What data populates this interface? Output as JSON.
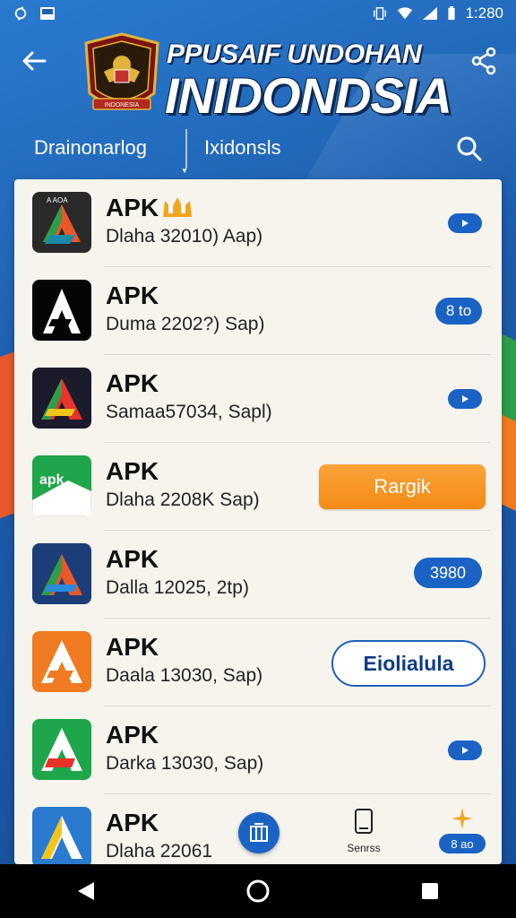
{
  "status_bar": {
    "time": "1:280",
    "icons": [
      "sync-icon",
      "gallery-icon",
      "vibrate-icon",
      "wifi-icon",
      "signal-icon",
      "battery-icon"
    ]
  },
  "header": {
    "title_top": "PPUSAIF UNDOHAN",
    "title_main": "INIDONDSIA",
    "emblem_text": "INDONESIA"
  },
  "tabs": {
    "left": "Drainonarlog",
    "right": "Ixidonsls"
  },
  "apps": [
    {
      "name": "APK",
      "sub": "Dlaha 32010) Aap)",
      "action": "",
      "action_type": "pill-sm",
      "icon": "apk-dark-icon",
      "icon_label": "A AOA"
    },
    {
      "name": "APK",
      "sub": "Duma 2202?) Sap)",
      "action": "8 to",
      "action_type": "pill-med",
      "icon": "apk-black-icon",
      "icon_label": ""
    },
    {
      "name": "APK",
      "sub": "Samaa57034, Sapl)",
      "action": "",
      "action_type": "pill-sm",
      "icon": "apk-red-icon",
      "icon_label": ""
    },
    {
      "name": "APK",
      "sub": "Dlaha 2208K Sap)",
      "action": "Rargik",
      "action_type": "orange",
      "icon": "apk-green-icon",
      "icon_label": "apk"
    },
    {
      "name": "APK",
      "sub": "Dalla 12025, 2tp)",
      "action": "3980",
      "action_type": "pill-big",
      "icon": "apk-navy-icon",
      "icon_label": ""
    },
    {
      "name": "APK",
      "sub": "Daala 13030, Sap)",
      "action": "Eiolialula",
      "action_type": "outline",
      "icon": "apk-orange-icon",
      "icon_label": ""
    },
    {
      "name": "APK",
      "sub": "Darka 13030, Sap)",
      "action": "",
      "action_type": "pill-sm",
      "icon": "apk-lime-icon",
      "icon_label": ""
    },
    {
      "name": "APK",
      "sub": "Dlaha 22061",
      "action": "",
      "action_type": "none",
      "icon": "apk-blue-icon",
      "icon_label": ""
    }
  ],
  "bottom": {
    "phone_label": "Senrss",
    "star_pill": "8 ao"
  },
  "colors": {
    "accent": "#1a63c4",
    "orange": "#f48a14",
    "background": "#1f5fae"
  }
}
